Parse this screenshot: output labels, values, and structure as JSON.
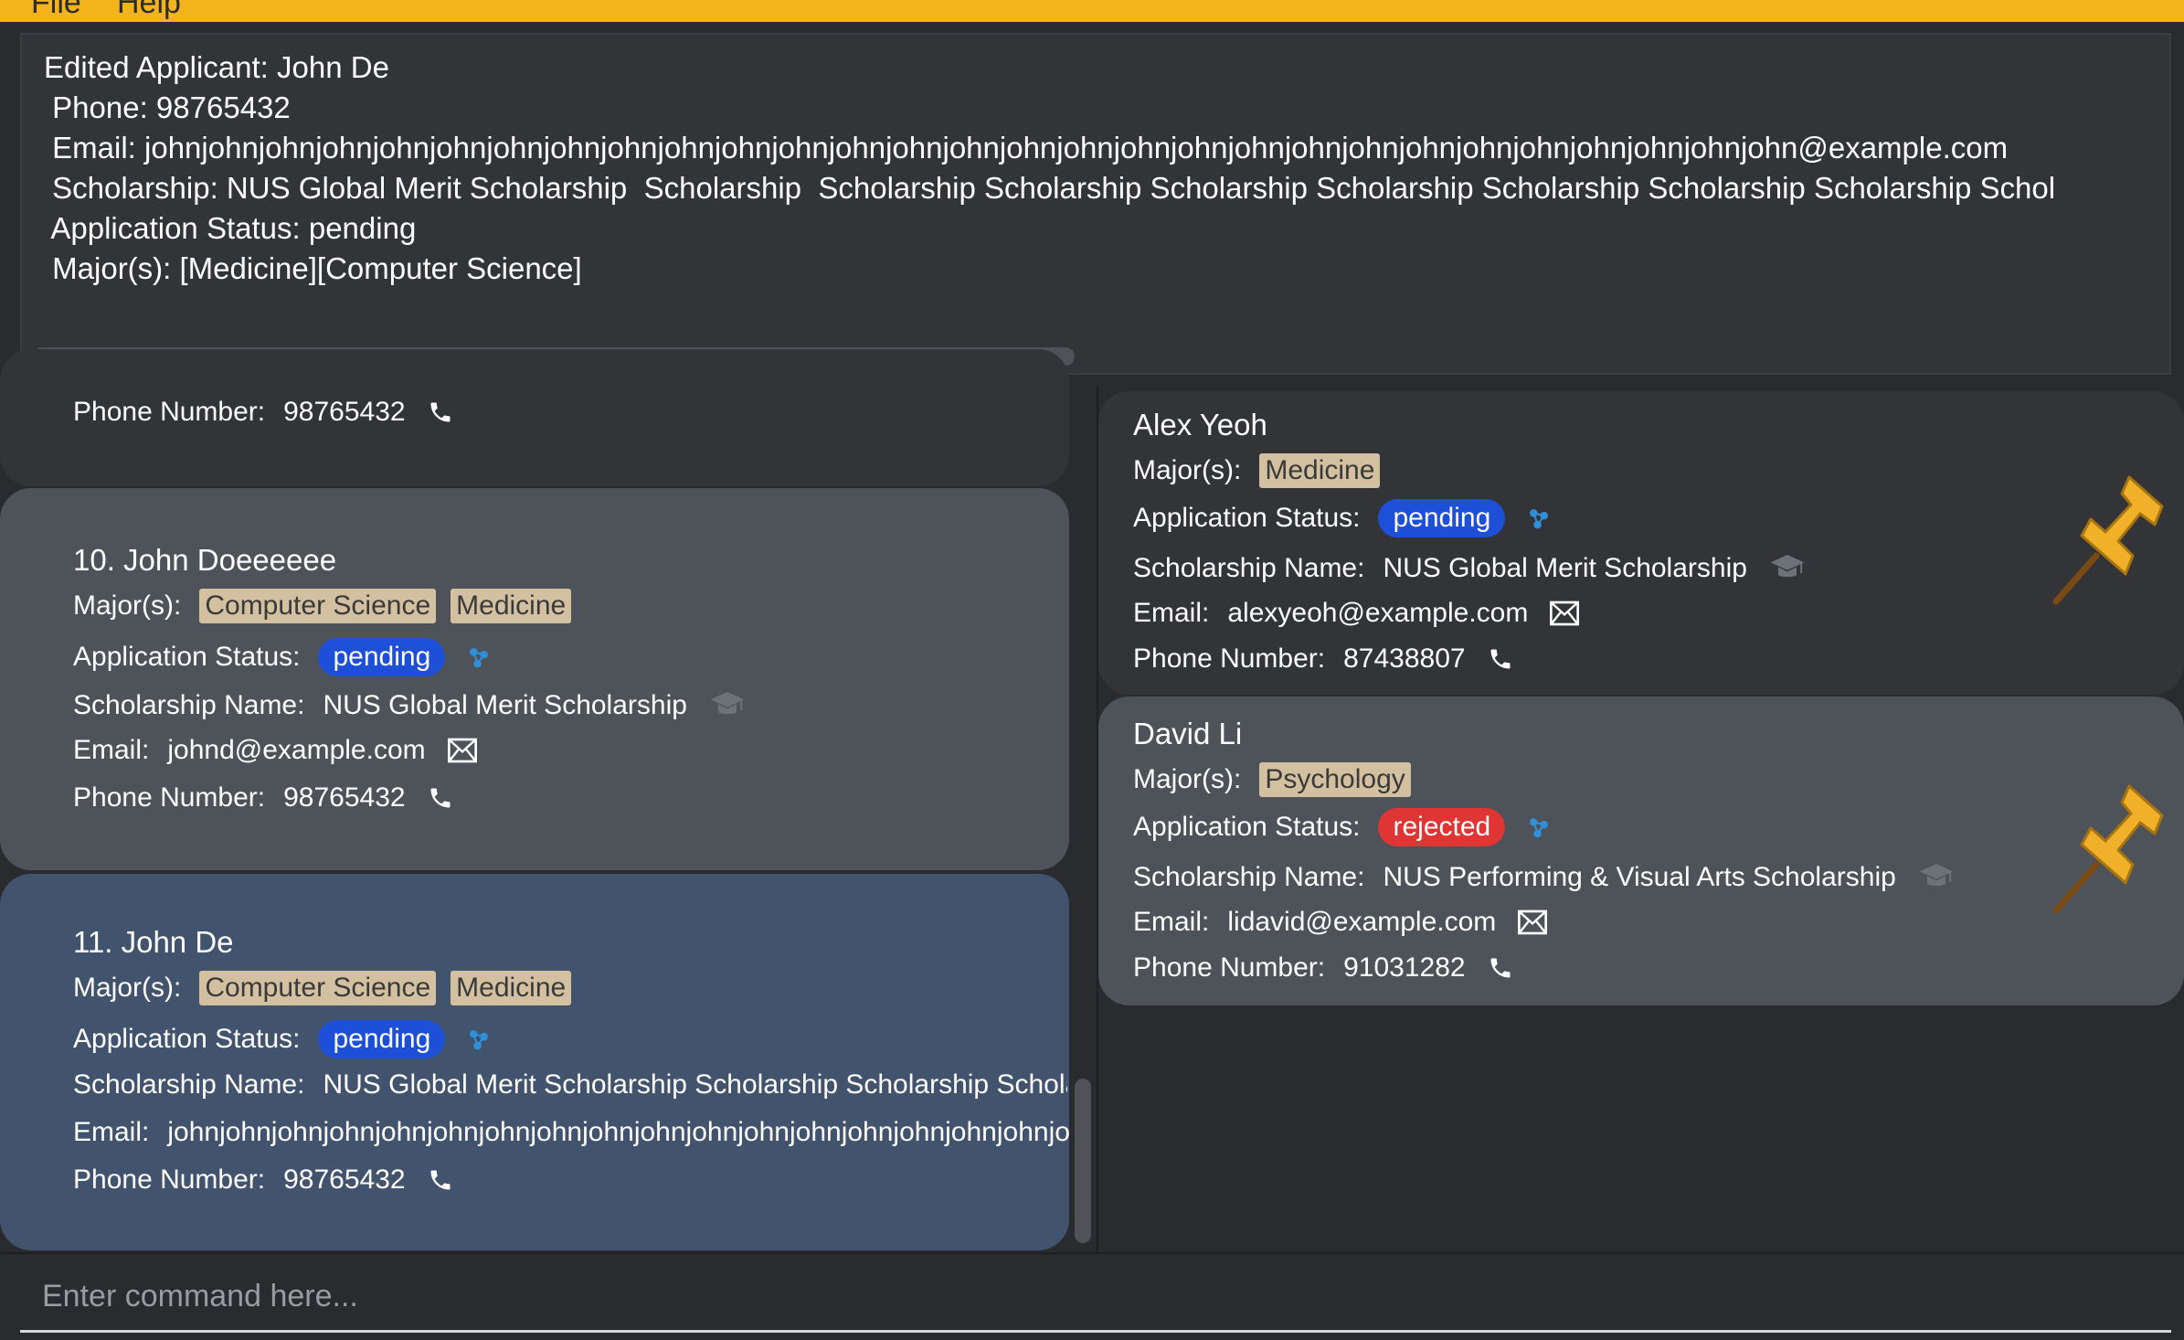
{
  "menu": {
    "file_label": "File",
    "help_label": "Help"
  },
  "result": {
    "lines": [
      "Edited Applicant: John De",
      " Phone: 98765432",
      " Email: johnjohnjohnjohnjohnjohnjohnjohnjohnjohnjohnjohnjohnjohnjohnjohnjohnjohnjohnjohnjohnjohnjohnjohnjohnjohnjohnjohnjohn@example.com",
      " Scholarship: NUS Global Merit Scholarship  Scholarship  Scholarship Scholarship Scholarship Scholarship Scholarship Scholarship Scholarship Schol",
      " Application Status: pending",
      " Major(s): [Medicine][Computer Science]"
    ]
  },
  "labels": {
    "major": "Major(s):",
    "status": "Application Status:",
    "scholarship": "Scholarship Name:",
    "email": "Email:",
    "phone": "Phone Number:"
  },
  "left_list": {
    "partial": {
      "phone": "98765432"
    },
    "cards": [
      {
        "index_name": "10.  John Doeeeeee",
        "majors": [
          "Computer Science",
          "Medicine"
        ],
        "status": "pending",
        "scholarship": "NUS Global Merit Scholarship",
        "email": "johnd@example.com",
        "phone": "98765432"
      },
      {
        "index_name": "11.  John De",
        "majors": [
          "Computer Science",
          "Medicine"
        ],
        "status": "pending",
        "scholarship": "NUS Global Merit Scholarship  Scholarship  Scholarship Scholarshi",
        "email": "johnjohnjohnjohnjohnjohnjohnjohnjohnjohnjohnjohnjohnjohnjohnjohnjohnjo",
        "phone": "98765432"
      }
    ]
  },
  "pinned_list": {
    "cards": [
      {
        "name": "Alex Yeoh",
        "majors": [
          "Medicine"
        ],
        "status": "pending",
        "scholarship": "NUS Global Merit Scholarship",
        "email": "alexyeoh@example.com",
        "phone": "87438807"
      },
      {
        "name": "David Li",
        "majors": [
          "Psychology"
        ],
        "status": "rejected",
        "scholarship": "NUS Performing & Visual Arts Scholarship",
        "email": "lidavid@example.com",
        "phone": "91031282"
      }
    ]
  },
  "command": {
    "placeholder": "Enter command here..."
  },
  "colors": {
    "menubar": "#f3b41b",
    "pending": "#1e4fd8",
    "rejected": "#e03535",
    "major_tag": "#d3c0a0",
    "selected_card": "#42536d"
  },
  "icons": [
    "phone-icon",
    "email-icon",
    "graduation-cap-icon",
    "status-network-icon",
    "pushpin-icon"
  ]
}
